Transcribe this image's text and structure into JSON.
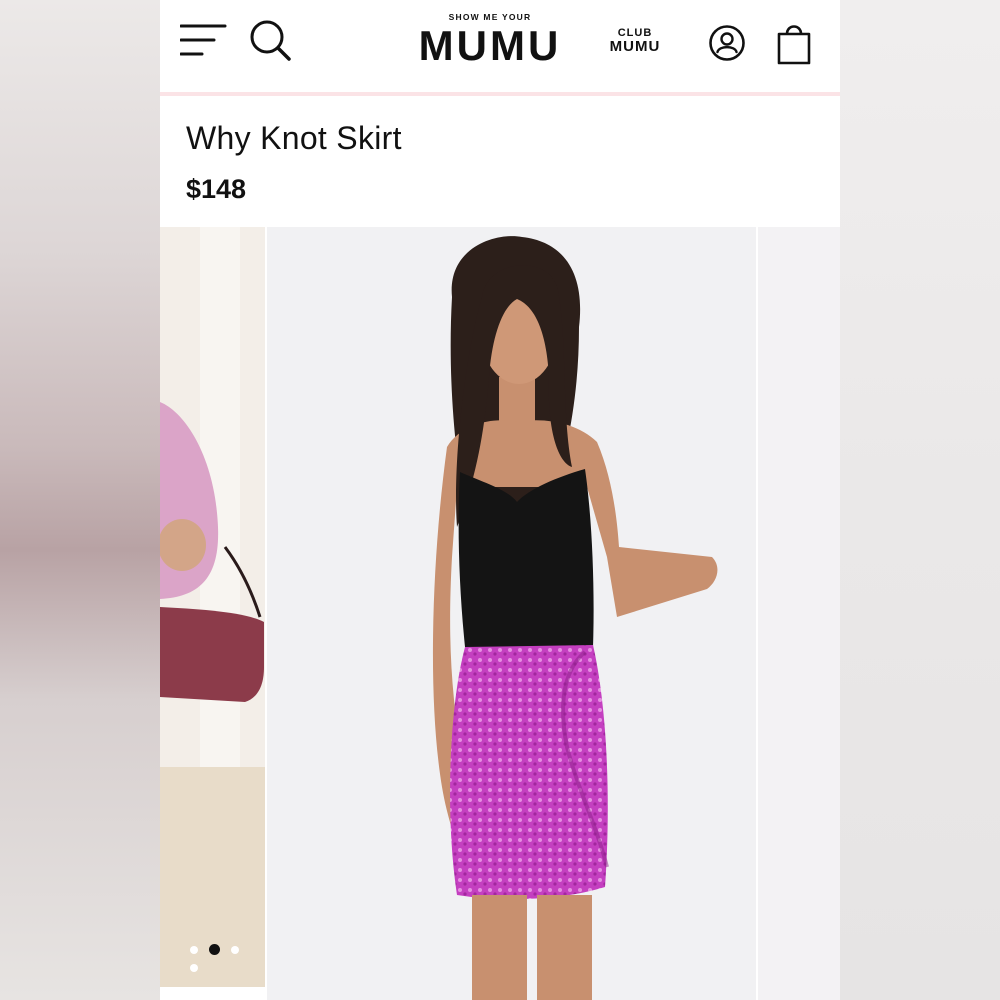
{
  "header": {
    "brand_small": "SHOW ME YOUR",
    "brand_big": "MUMU",
    "club_small": "CLUB",
    "club_big": "MUMU",
    "icons": [
      "menu-icon",
      "search-icon",
      "account-icon",
      "shopping-bag-icon"
    ]
  },
  "product": {
    "title": "Why Knot Skirt",
    "price": "$148"
  },
  "gallery": {
    "dot_count": 4,
    "active_dot": 2
  },
  "colors": {
    "header_divider": "#fbe3e6",
    "skirt": "#c43fc0",
    "text": "#111111"
  }
}
